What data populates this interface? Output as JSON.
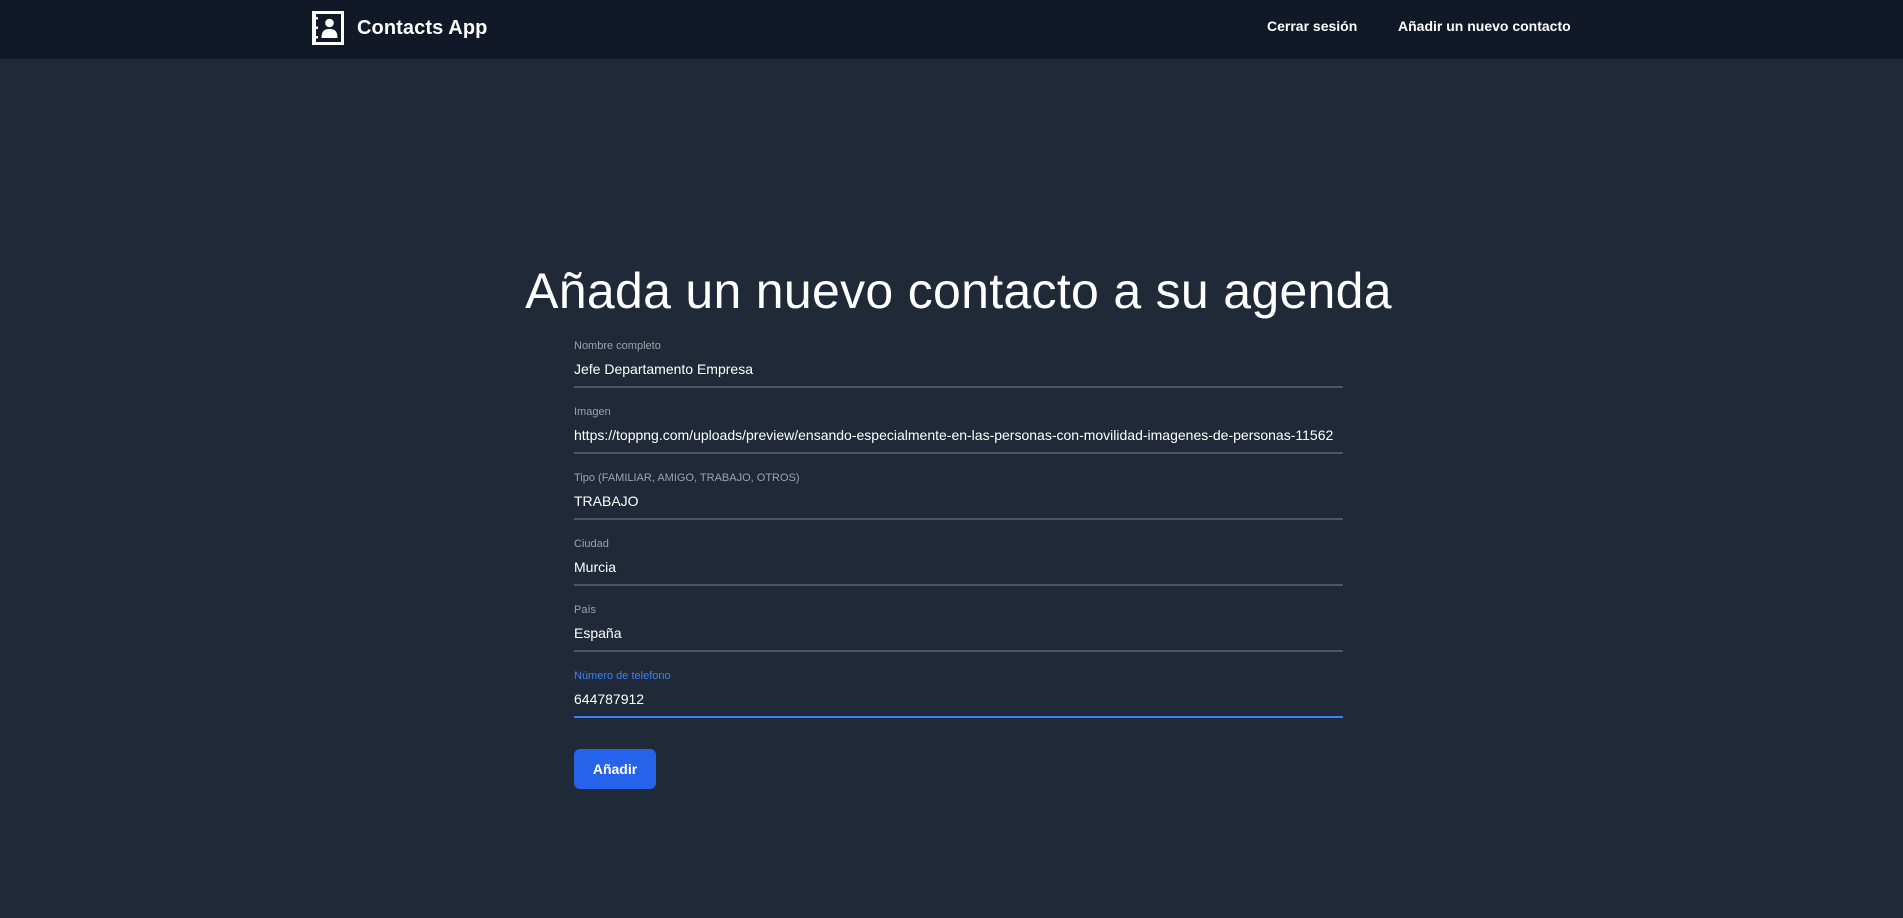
{
  "navbar": {
    "brand_name": "Contacts App",
    "logo_icon": "contact-book-icon",
    "logout_label": "Cerrar sesión",
    "add_contact_label": "Añadir un nuevo contacto",
    "background": "#111827"
  },
  "main": {
    "title": "Añada un nuevo contacto a su agenda",
    "background": "#1f2937"
  },
  "form": {
    "fields": [
      {
        "label": "Nombre completo",
        "value": "Jefe Departamento Empresa"
      },
      {
        "label": "Imagen",
        "value": "https://toppng.com/uploads/preview/ensando-especialmente-en-las-personas-con-movilidad-imagenes-de-personas-11562"
      },
      {
        "label": "Tipo (FAMILIAR, AMIGO, TRABAJO, OTROS)",
        "value": "TRABAJO"
      },
      {
        "label": "Ciudad",
        "value": "Murcia"
      },
      {
        "label": "País",
        "value": "España"
      },
      {
        "label": "Número de telefono",
        "value": "644787912",
        "focused": true
      }
    ],
    "submit_label": "Añadir"
  },
  "colors": {
    "accent": "#2563eb",
    "focus": "#3b82f6",
    "label": "#9ca3af",
    "underline": "#4b5563"
  }
}
